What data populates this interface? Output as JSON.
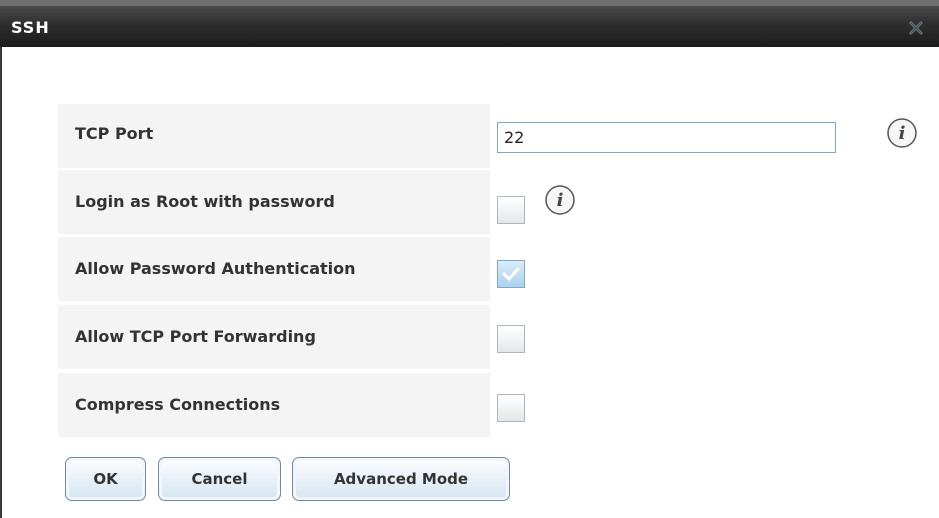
{
  "dialog": {
    "title": "SSH"
  },
  "form": {
    "tcp_port": {
      "label": "TCP Port",
      "value": "22"
    },
    "login_root": {
      "label": "Login as Root with password",
      "checked": false
    },
    "allow_password_auth": {
      "label": "Allow Password Authentication",
      "checked": true
    },
    "allow_tcp_forwarding": {
      "label": "Allow TCP Port Forwarding",
      "checked": false
    },
    "compress": {
      "label": "Compress Connections",
      "checked": false
    }
  },
  "buttons": {
    "ok": "OK",
    "cancel": "Cancel",
    "advanced": "Advanced Mode"
  },
  "colors": {
    "titlebar": "#2e2e2e",
    "input_border": "#7fa7cc",
    "button_border": "#6e8aa6"
  }
}
